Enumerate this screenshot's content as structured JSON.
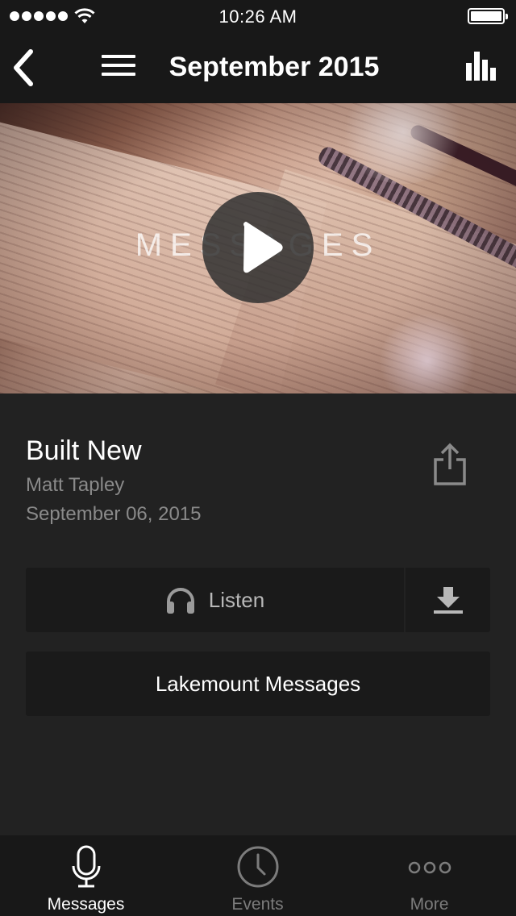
{
  "status_bar": {
    "time": "10:26 AM"
  },
  "nav": {
    "title": "September 2015"
  },
  "hero": {
    "overlay_text": "MESSAGES"
  },
  "message": {
    "title": "Built New",
    "speaker": "Matt Tapley",
    "date": "September 06, 2015"
  },
  "actions": {
    "listen_label": "Listen",
    "series_label": "Lakemount Messages"
  },
  "tab_bar": {
    "tabs": [
      {
        "label": "Messages",
        "icon": "microphone-icon",
        "active": true
      },
      {
        "label": "Events",
        "icon": "clock-icon",
        "active": false
      },
      {
        "label": "More",
        "icon": "more-dots-icon",
        "active": false
      }
    ]
  },
  "colors": {
    "background": "#222222",
    "bar_background": "#181818",
    "button_background": "#1a1a1a",
    "secondary_text": "#8a8a8a",
    "inactive_tab": "#7c7c7c"
  }
}
